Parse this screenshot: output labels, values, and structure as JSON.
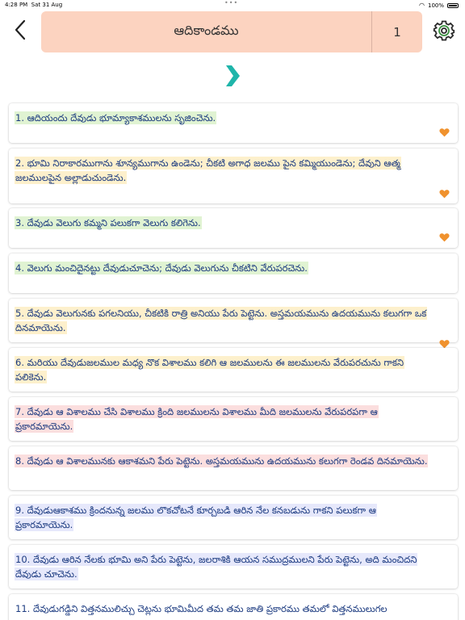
{
  "status_bar": {
    "time": "4:28 PM",
    "date": "Sat 31 Aug",
    "battery": "100%",
    "icons": [
      "wifi-icon",
      "battery-icon"
    ]
  },
  "header": {
    "back_icon": "chevron-left-icon",
    "book_title": "ఆదికాండము",
    "chapter_number": "1",
    "settings_icon": "gear-icon"
  },
  "navigation": {
    "next_icon": "chevron-right-icon"
  },
  "colors": {
    "title_bg": "#fcd3c0",
    "accent_teal": "#1fb5aa",
    "heart": "#f0922e",
    "highlight_green": "#e0f3d2",
    "highlight_yellow": "#fdf0cc",
    "highlight_pink": "#fbdede",
    "highlight_lavender": "#e6e8fb",
    "verse_text": "#1c3b80"
  },
  "verses": [
    {
      "text": "1. ఆదియందు దేవుడు భూమ్యాకాశములను సృజించెను.",
      "highlight": "green",
      "favorited": true
    },
    {
      "text": "2. భూమి నిరాకారముగాను శూన్యముగాను ఉండెను; చీకటి అగాధ జలము పైన కమ్మియుండెను; దేవుని ఆత్మ జలములపైన అల్లాడుచుండెను.",
      "highlight": "yellow",
      "favorited": true
    },
    {
      "text": "3. దేవుడు వెలుగు కమ్మని  పలుకగా వెలుగు కలిగెను.",
      "highlight": "green",
      "favorited": true
    },
    {
      "text": "4. వెలుగు మంచిదైనట్టు దేవుడుచూచెను; దేవుడు వెలుగును చీకటిని వేరుపరచెను.",
      "highlight": "green",
      "favorited": false
    },
    {
      "text": "5. దేవుడు వెలుగునకు పగలనియు, చీకటికి రాత్రి అనియు పేరు పెట్టెను. అస్తమయమును ఉదయమును కలుగగా ఒక దినమాయెను.",
      "highlight": "yellow",
      "favorited": true
    },
    {
      "text": "6. మరియు దేవుడుజలముల మధ్య నొక విశాలము కలిగి ఆ జలములను ఈ జలములను వేరుపరచును గాకని పలికెను.",
      "highlight": "yellow",
      "favorited": false
    },
    {
      "text": "7. దేవుడు ఆ విశాలము చేసి విశాలము క్రింది జలములను విశాలము మీది జలములను వేరుపరపగా ఆ ప్రకారమాయెను.",
      "highlight": "pink",
      "favorited": false
    },
    {
      "text": "8. దేవుడు ఆ విశాలమునకు ఆకాశమని పేరు పెట్టెను. అస్తమయమును ఉదయమును కలుగగా రెండవ దినమాయెను.",
      "highlight": "pink",
      "favorited": false
    },
    {
      "text": "9. దేవుడుఆకాశము క్రిందనున్న జలము లొకచోటనే కూర్చబడి ఆరిన నేల కనబడును గాకని పలుకగా ఆ ప్రకారమాయెను.",
      "highlight": "lavender",
      "favorited": false
    },
    {
      "text": "10. దేవుడు ఆరిన నేలకు భూమి అని పేరు పెట్టెను, జలరాశికి ఆయన సముద్రములని పేరు పెట్టెను, అది మంచిదని దేవుడు చూచెను.",
      "highlight": "lavender",
      "favorited": false
    },
    {
      "text": "11. దేవుడుగడ్డిని విత్తనములిచ్చు చెట్లను భూమిమీద తమ తమ జాతి ప్రకారము తమలో విత్తనములుగల",
      "highlight": "none",
      "favorited": false
    }
  ]
}
